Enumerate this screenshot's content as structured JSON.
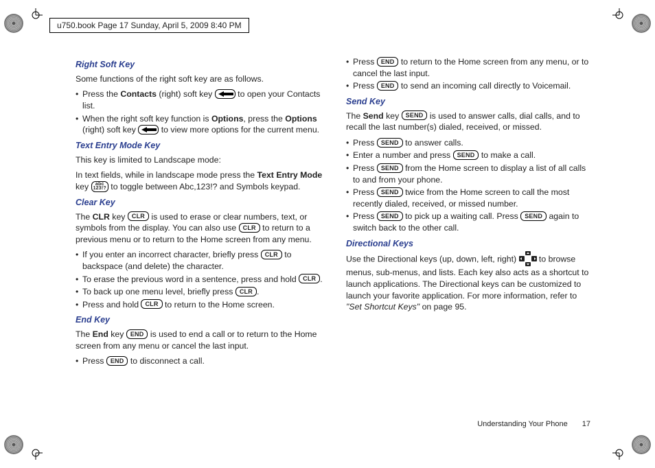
{
  "header": {
    "running": "u750.book  Page 17  Sunday, April 5, 2009  8:40 PM"
  },
  "keys": {
    "clr": "CLR",
    "end": "END",
    "send": "SEND",
    "abc_top": "abc",
    "abc_bot": "123!?"
  },
  "left": {
    "rightSoft": {
      "head": "Right Soft Key",
      "intro": "Some functions of the right soft key are as follows.",
      "b1a": "Press the ",
      "b1b": "Contacts",
      "b1c": " (right) soft key ",
      "b1d": " to open your Contacts list.",
      "b2a": "When the right soft key function is ",
      "b2b": "Options",
      "b2c": ", press the ",
      "b2d": "Options",
      "b2e": " (right) soft key ",
      "b2f": " to view more options for the current menu."
    },
    "textEntry": {
      "head": "Text Entry Mode Key",
      "p1": "This key is limited to Landscape mode:",
      "p2a": "In text fields, while in landscape mode press the ",
      "p2b": "Text Entry Mode",
      "p2c": " key ",
      "p2d": " to toggle between Abc,123!? and Symbols keypad."
    },
    "clear": {
      "head": "Clear Key",
      "p1a": "The ",
      "p1b": "CLR",
      "p1c": " key ",
      "p1d": " is used to erase or clear numbers, text, or symbols from the display. You can also use ",
      "p1e": " to return to a previous menu or to return to the Home screen from any menu.",
      "b1a": "If you enter an incorrect character, briefly press ",
      "b1b": " to backspace (and delete) the character.",
      "b2a": "To erase the previous word in a sentence, press and hold ",
      "b2b": ".",
      "b3a": "To back up one menu level, briefly press ",
      "b3b": ".",
      "b4a": "Press and hold ",
      "b4b": " to return to the Home screen."
    },
    "end": {
      "head": "End Key",
      "p1a": "The ",
      "p1b": "End",
      "p1c": " key ",
      "p1d": " is used to end a call or to return to the Home screen from any menu or cancel the last input.",
      "b1a": "Press ",
      "b1b": " to disconnect a call."
    }
  },
  "right": {
    "endCont": {
      "b1a": "Press ",
      "b1b": " to return to the Home screen from any menu, or to cancel the last input.",
      "b2a": "Press ",
      "b2b": " to send an incoming call directly to Voicemail."
    },
    "send": {
      "head": "Send Key",
      "p1a": "The ",
      "p1b": "Send",
      "p1c": " key ",
      "p1d": " is used to answer calls, dial calls, and to recall the last number(s) dialed, received, or missed.",
      "b1a": "Press ",
      "b1b": " to answer calls.",
      "b2a": "Enter a number and press ",
      "b2b": " to make a call.",
      "b3a": "Press ",
      "b3b": " from the Home screen to display a list of all calls to and from your phone.",
      "b4a": "Press ",
      "b4b": " twice from the Home screen to call the most recently dialed, received, or missed number.",
      "b5a": "Press ",
      "b5b": " to pick up a waiting call. Press ",
      "b5c": " again to switch back to the other call."
    },
    "dir": {
      "head": "Directional Keys",
      "p1a": "Use the Directional keys (up, down, left, right) ",
      "p1b": " to browse menus, sub-menus, and lists. Each key also acts as a shortcut to launch applications. The Directional keys can be customized to launch your favorite application. For more information, refer to ",
      "p1c": "\"Set Shortcut Keys\"",
      "p1d": "  on page 95."
    }
  },
  "footer": {
    "section": "Understanding Your Phone",
    "page": "17"
  }
}
